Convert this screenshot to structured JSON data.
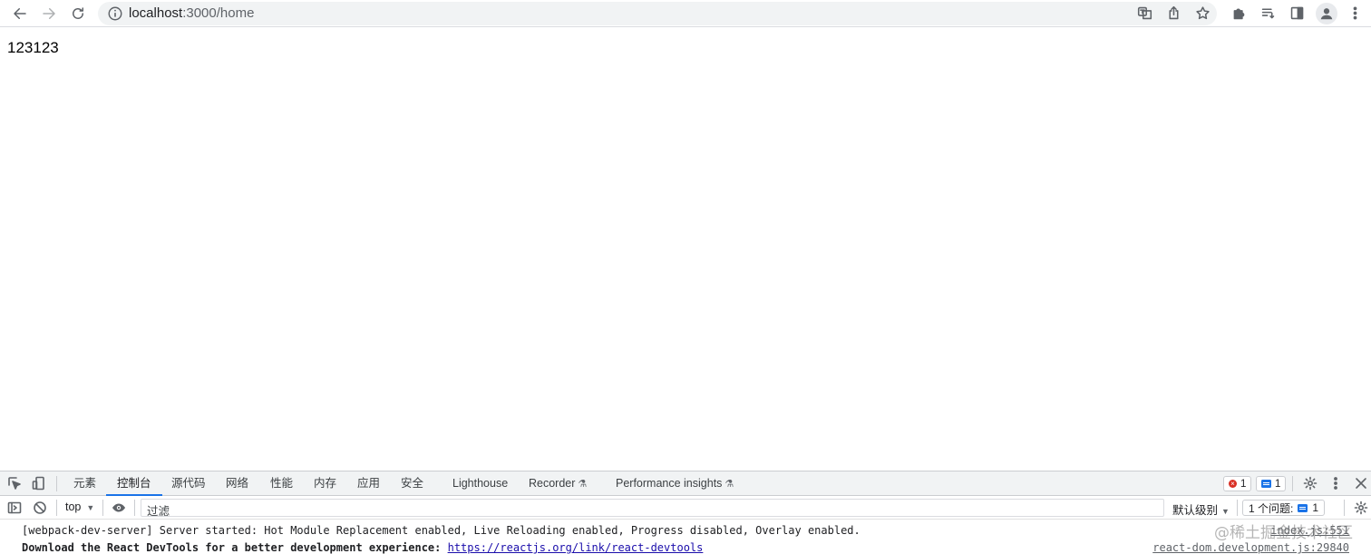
{
  "browser": {
    "url_host": "localhost",
    "url_rest": ":3000/home",
    "icons": [
      "back-icon",
      "forward-icon",
      "reload-icon",
      "info-icon",
      "translate-icon",
      "share-icon",
      "star-icon",
      "extensions-icon",
      "reading-list-icon",
      "side-panel-icon",
      "profile-icon",
      "menu-icon"
    ]
  },
  "page": {
    "text": "123123"
  },
  "devtools": {
    "tabs": [
      {
        "label": "元素"
      },
      {
        "label": "控制台"
      },
      {
        "label": "源代码"
      },
      {
        "label": "网络"
      },
      {
        "label": "性能"
      },
      {
        "label": "内存"
      },
      {
        "label": "应用"
      },
      {
        "label": "安全"
      },
      {
        "label": "Lighthouse"
      },
      {
        "label": "Recorder"
      },
      {
        "label": "Performance insights"
      }
    ],
    "error_count": "1",
    "message_count": "1",
    "context": "top",
    "filter_placeholder": "过滤",
    "levels": "默认级别",
    "issues_label": "1 个问题:",
    "issues_count": "1",
    "logs": [
      {
        "text": "[webpack-dev-server] Server started: Hot Module Replacement enabled, Live Reloading enabled, Progress disabled, Overlay enabled.",
        "source": "index.js:551"
      },
      {
        "text": "Download the React DevTools for a better development experience: ",
        "link": "https://reactjs.org/link/react-devtools",
        "source": "react-dom.development.js:29840"
      }
    ],
    "watermark": "@稀土掘金技术社区"
  }
}
